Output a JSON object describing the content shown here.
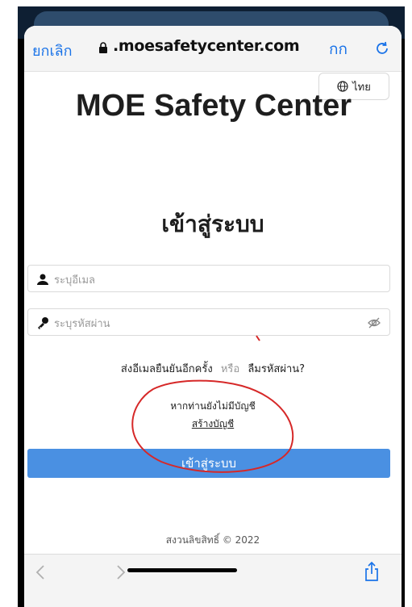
{
  "browser": {
    "cancel_label": "ยกเลิก",
    "url": ".moesafetycenter.com",
    "text_size_label": "กก",
    "lock_icon": "lock-icon",
    "reload_icon": "reload-icon"
  },
  "page": {
    "language_button": "ไทย",
    "title": "MOE Safety Center",
    "login_heading": "เข้าสู่ระบบ",
    "email_placeholder": "ระบุอีเมล",
    "password_placeholder": "ระบุรหัสผ่าน",
    "resend_link": "ส่งอีเมลยืนยันอีกครั้ง",
    "or_text": "หรือ",
    "forgot_link": "ลืมรหัสผ่าน?",
    "no_account_text": "หากท่านยังไม่มีบัญชี",
    "create_account_link": "สร้างบัญชี",
    "login_button": "เข้าสู่ระบบ",
    "footer": "สงวนลิขสิทธิ์ © 2022"
  },
  "colors": {
    "link_blue": "#1a73e8",
    "primary_button": "#4a90e2",
    "annotation_red": "#d62828"
  }
}
